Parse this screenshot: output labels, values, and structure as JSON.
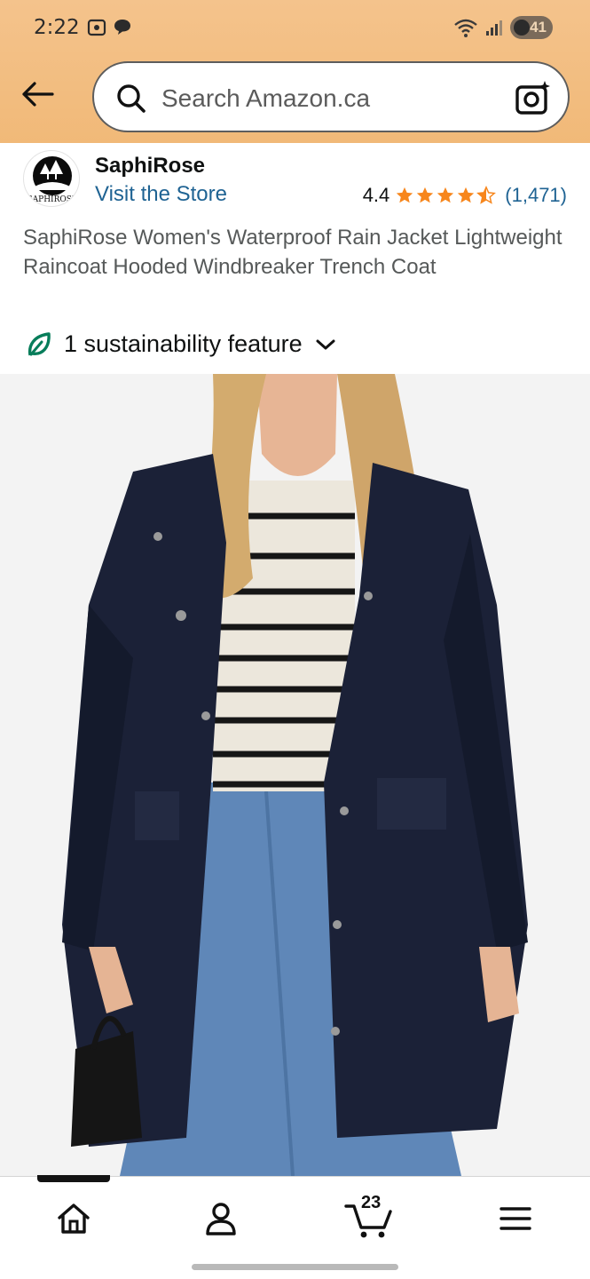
{
  "status_bar": {
    "time": "2:22",
    "battery": "41"
  },
  "header": {
    "search_placeholder": "Search Amazon.ca"
  },
  "brand": {
    "name": "SaphiRose",
    "logo_text": "SAPHIROSE",
    "visit_store_label": "Visit the Store"
  },
  "rating": {
    "value": "4.4",
    "stars": 4.4,
    "count": "(1,471)"
  },
  "product": {
    "title": "SaphiRose Women's Waterproof Rain Jacket Lightweight Raincoat Hooded Windbreaker Trench Coat",
    "sustainability_label": "1 sustainability feature"
  },
  "bottom_nav": {
    "items": [
      "home-icon",
      "account-icon",
      "cart-icon",
      "menu-icon"
    ],
    "cart_count": "23"
  },
  "colors": {
    "header_bg": "#f2bd80",
    "link": "#1f6393",
    "star": "#f7861c",
    "sustain_green": "#077d5a"
  }
}
